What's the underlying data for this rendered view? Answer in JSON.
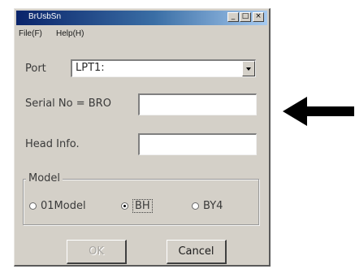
{
  "window": {
    "title": "BrUsbSn"
  },
  "titlebar_buttons": {
    "minimize": "_",
    "maximize": "□",
    "close": "×"
  },
  "menu": {
    "items": [
      {
        "label": "File(F)"
      },
      {
        "label": "Help(H)"
      }
    ]
  },
  "form": {
    "port_label": "Port",
    "port_value": "LPT1:",
    "serial_label": "Serial No = BRO",
    "serial_value": "",
    "head_label": "Head Info.",
    "head_value": ""
  },
  "model": {
    "group_label": "Model",
    "options": [
      {
        "label": "01Model",
        "selected": false
      },
      {
        "label": "BH",
        "selected": true
      },
      {
        "label": "BY4",
        "selected": false
      }
    ]
  },
  "buttons": {
    "ok_label": "OK",
    "ok_enabled": false,
    "cancel_label": "Cancel"
  },
  "annotation": {
    "arrow_icon": "left-arrow-icon",
    "arrow_color": "#000000"
  }
}
